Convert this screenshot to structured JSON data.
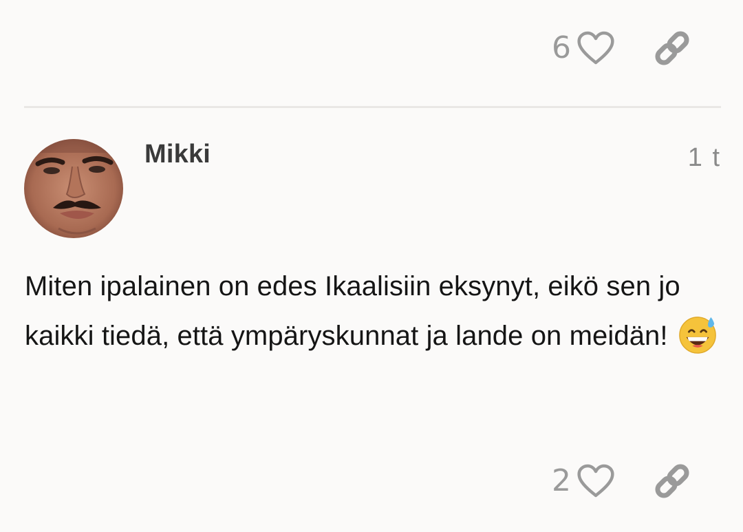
{
  "top_actions": {
    "like_count": "6",
    "heart_icon": "heart-outline-icon",
    "link_icon": "link-icon"
  },
  "comment": {
    "author": "Mikki",
    "time": "1 t",
    "text": "Miten ipalainen on edes Ikaalisiin eksynyt, eikö sen jo kaikki tiedä, että ympäryskunnat ja lande on meidän!",
    "emoji": "grinning-face-with-sweat-emoji",
    "actions": {
      "like_count": "2",
      "heart_icon": "heart-outline-icon",
      "link_icon": "link-icon"
    }
  },
  "colors": {
    "background": "#fbfaf9",
    "icon_gray": "#9a9a9a",
    "text": "#151515"
  }
}
